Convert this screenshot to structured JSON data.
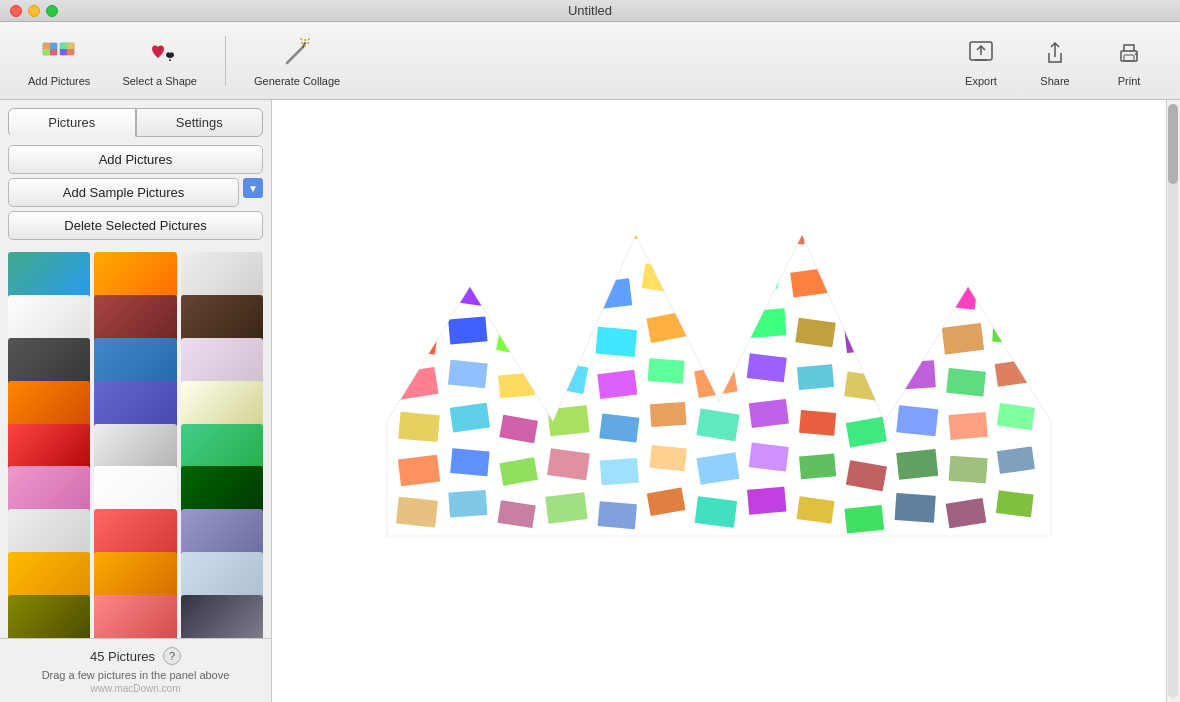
{
  "window": {
    "title": "Untitled"
  },
  "toolbar": {
    "add_pictures_label": "Add Pictures",
    "select_shape_label": "Select a Shape",
    "generate_collage_label": "Generate Collage",
    "export_label": "Export",
    "share_label": "Share",
    "print_label": "Print"
  },
  "tabs": [
    {
      "id": "pictures",
      "label": "Pictures",
      "active": true
    },
    {
      "id": "settings",
      "label": "Settings",
      "active": false
    }
  ],
  "sidebar": {
    "add_pictures_btn": "Add Pictures",
    "add_sample_btn": "Add Sample Pictures",
    "delete_btn": "Delete Selected Pictures",
    "picture_count": "45 Pictures",
    "drag_hint": "Drag a few pictures in the panel above",
    "watermark": "www.macDown.com",
    "help_label": "?"
  },
  "collage": {
    "shape": "crown"
  }
}
